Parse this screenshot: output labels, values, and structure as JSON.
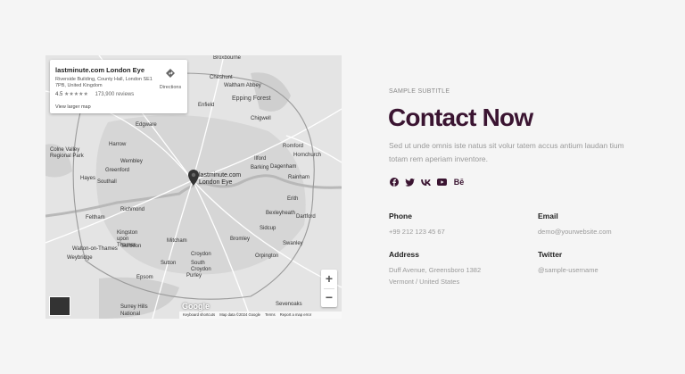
{
  "map": {
    "card": {
      "title": "lastminute.com London Eye",
      "address": "Riverside Building, County Hall, London SE1 7PB, United Kingdom",
      "rating": "4.5",
      "stars": "★★★★★",
      "reviews": "173,900 reviews",
      "larger_map": "View larger map",
      "directions": "Directions"
    },
    "pin_label": "lastminute.com London Eye",
    "places": [
      "Broxbourne",
      "Cheshunt",
      "Waltham Abbey",
      "Enfield",
      "Epping Forest",
      "Chigwell",
      "Edgware",
      "Harrow",
      "Wembley",
      "Colne Valley Regional Park",
      "Greenford",
      "Hayes",
      "Southall",
      "Ilford",
      "Barking",
      "Romford",
      "Hornchurch",
      "Dagenham",
      "Rainham",
      "Erith",
      "Richmond",
      "Feltham",
      "Kingston upon Thames",
      "Walton-on-Thames",
      "Weybridge",
      "Mitcham",
      "Croydon",
      "South Croydon",
      "Purley",
      "Bromley",
      "Sidcup",
      "Swanley",
      "Bexleyheath",
      "Dartford",
      "Orpington",
      "Sutton",
      "Epsom",
      "Surbiton",
      "Surrey Hills National",
      "Sevenoaks"
    ],
    "zoom_in": "+",
    "zoom_out": "−",
    "google": "Google",
    "attribution": {
      "shortcuts": "Keyboard shortcuts",
      "data": "Map data ©2024 Google",
      "terms": "Terms",
      "report": "Report a map error"
    }
  },
  "contact": {
    "subtitle": "SAMPLE SUBTITLE",
    "heading": "Contact Now",
    "description": "Sed ut unde omnis iste natus sit volur tatem accus antium laudan tium totam rem aperiam inventore.",
    "social_icons": [
      "facebook-icon",
      "twitter-icon",
      "vk-icon",
      "youtube-icon",
      "behance-icon"
    ],
    "phone_label": "Phone",
    "phone_value": "+99 212 123 45 67",
    "email_label": "Email",
    "email_value": "demo@yourwebsite.com",
    "address_label": "Address",
    "address_line1": "Duff Avenue, Greensboro 1382",
    "address_line2": "Vermont / United States",
    "twitter_label": "Twitter",
    "twitter_value": "@sample-username"
  },
  "colors": {
    "heading": "#3a1431",
    "muted": "#9a9a9a",
    "background": "#f5f5f5"
  }
}
